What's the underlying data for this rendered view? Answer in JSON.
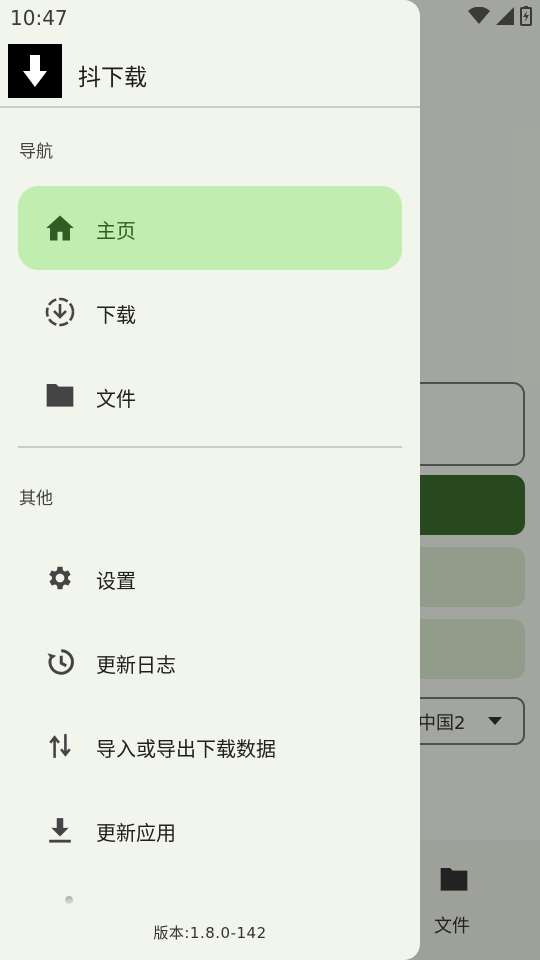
{
  "status_bar": {
    "time": "10:47"
  },
  "app": {
    "title": "抖下载"
  },
  "drawer": {
    "section_nav": "导航",
    "nav_items": [
      {
        "label": "主页",
        "icon": "home-icon",
        "active": true
      },
      {
        "label": "下载",
        "icon": "download-circle-icon",
        "active": false
      },
      {
        "label": "文件",
        "icon": "folder-icon",
        "active": false
      }
    ],
    "section_other": "其他",
    "other_items": [
      {
        "label": "设置",
        "icon": "gear-icon"
      },
      {
        "label": "更新日志",
        "icon": "history-icon"
      },
      {
        "label": "导入或导出下载数据",
        "icon": "import-export-icon"
      },
      {
        "label": "更新应用",
        "icon": "download-icon"
      }
    ],
    "version": "版本:1.8.0-142"
  },
  "background": {
    "select_value": "中国2",
    "bottom_nav_label": "文件"
  },
  "colors": {
    "drawer_bg": "#f2f5ec",
    "active_item_bg": "#c1edb1",
    "active_item_fg": "#2f5d23",
    "primary": "#3b6a2c"
  }
}
